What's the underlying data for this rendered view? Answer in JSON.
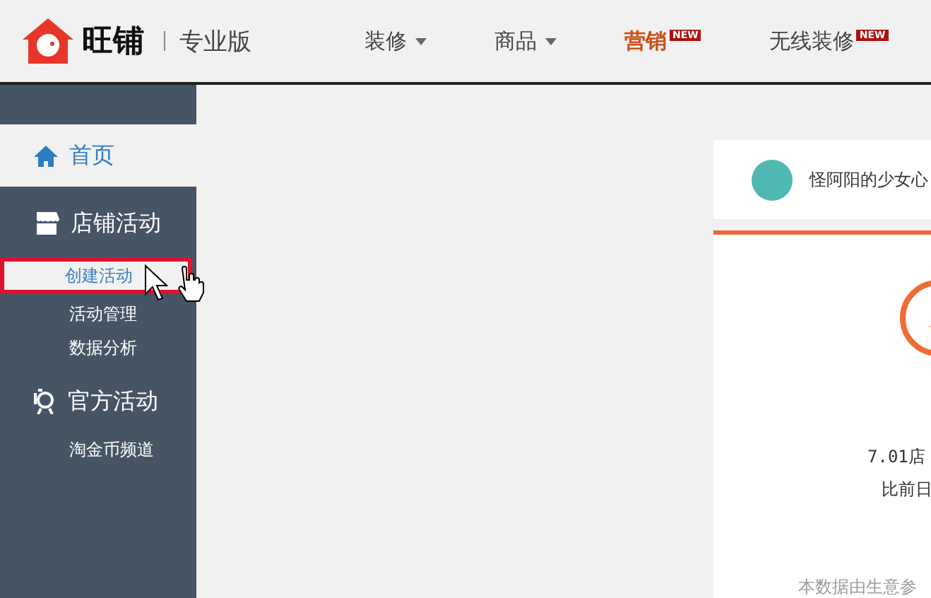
{
  "header": {
    "brand": "旺铺",
    "edition": "专业版",
    "nav": [
      {
        "label": "装修",
        "dropdown": true,
        "selected": false
      },
      {
        "label": "商品",
        "dropdown": true,
        "selected": false
      },
      {
        "label": "营销",
        "dropdown": false,
        "badge": "NEW",
        "selected": true
      },
      {
        "label": "无线装修",
        "dropdown": false,
        "badge": "NEW",
        "selected": false
      }
    ]
  },
  "sidebar": {
    "items": [
      {
        "label": "首页",
        "kind": "home",
        "selected": true
      },
      {
        "label": "店铺活动",
        "kind": "shop",
        "selected": false,
        "children": [
          {
            "label": "创建活动",
            "selected": true
          },
          {
            "label": "活动管理",
            "selected": false
          },
          {
            "label": "数据分析",
            "selected": false
          }
        ]
      },
      {
        "label": "官方活动",
        "kind": "badge",
        "selected": false,
        "children": [
          {
            "label": "淘金币频道",
            "selected": false
          }
        ]
      }
    ]
  },
  "card": {
    "shop_name": "怪阿阳的少女心",
    "stat_line": "7.01店",
    "compare_line": "比前日",
    "note": "本数据由生意参"
  }
}
